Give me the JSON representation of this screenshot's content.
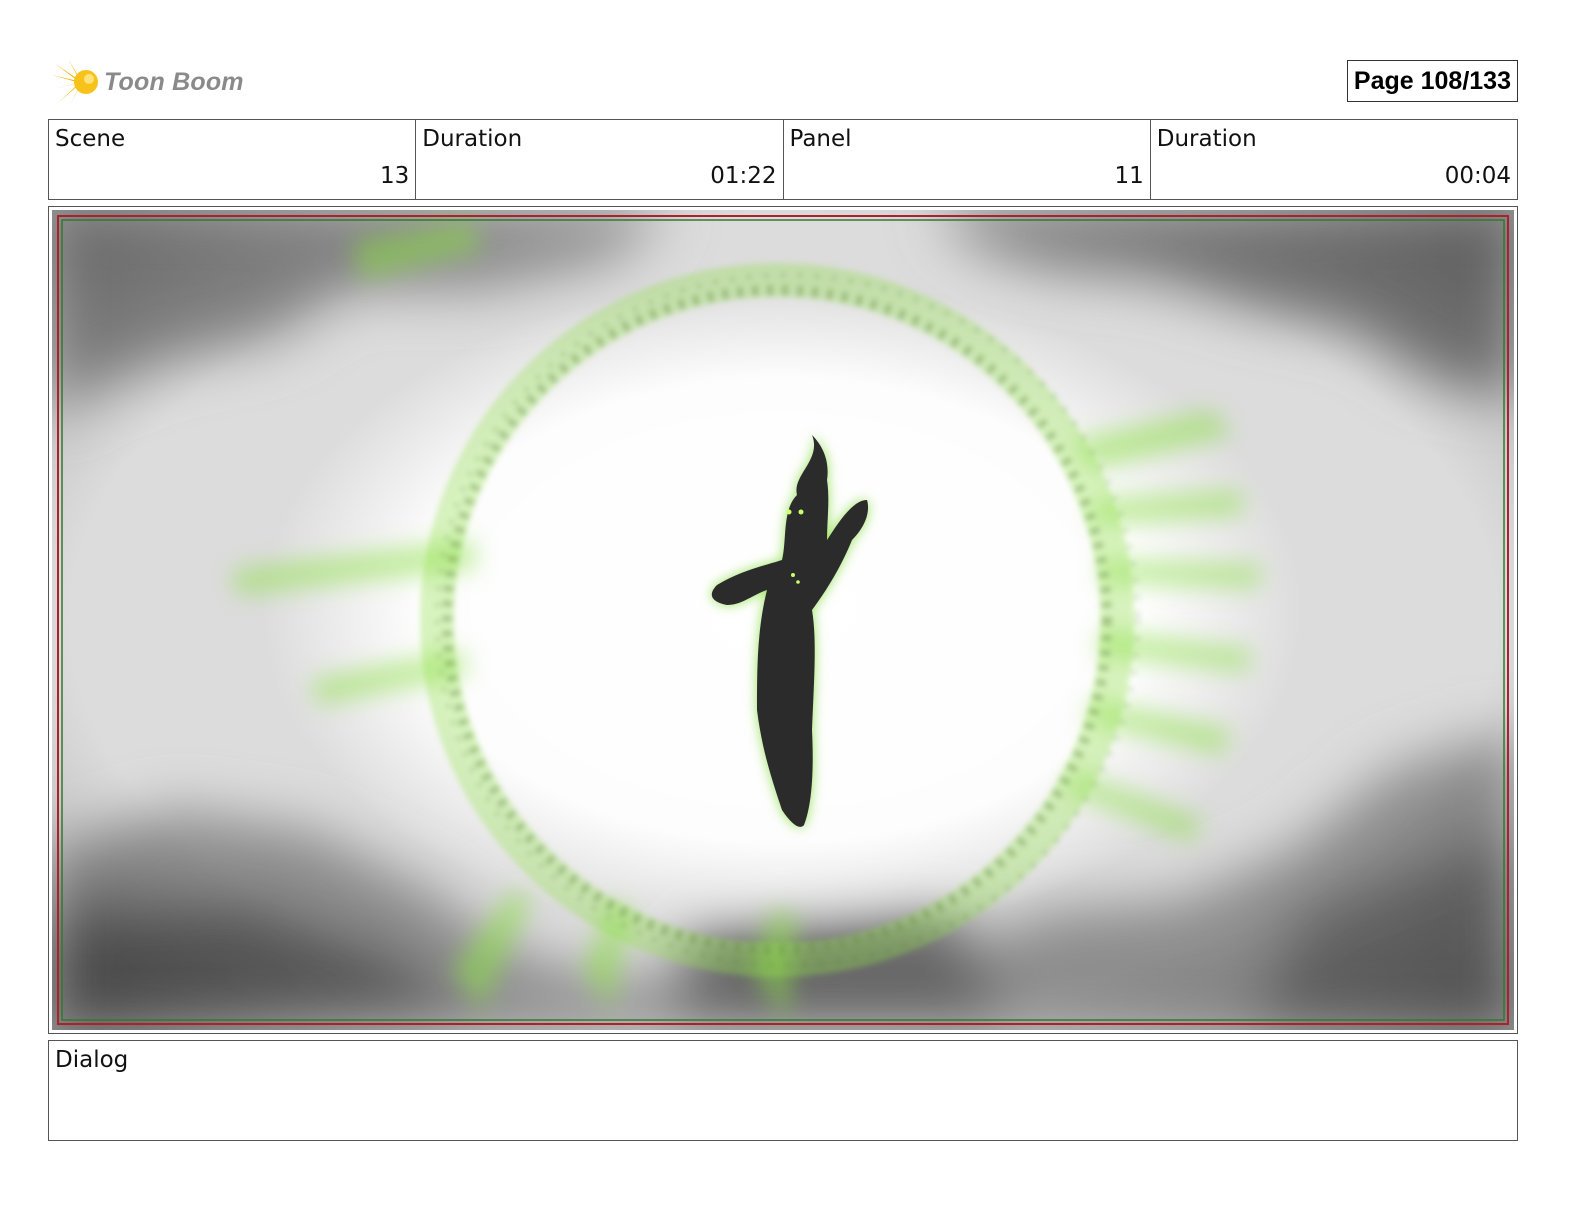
{
  "header": {
    "brand": "Toon Boom",
    "page": "Page 108/133"
  },
  "info": {
    "scene_label": "Scene",
    "scene_value": "13",
    "scene_duration_label": "Duration",
    "scene_duration_value": "01:22",
    "panel_label": "Panel",
    "panel_value": "11",
    "panel_duration_label": "Duration",
    "panel_duration_value": "00:04"
  },
  "dialog": {
    "label": "Dialog",
    "text": ""
  },
  "colors": {
    "brand_orange": "#f5b400",
    "glow_green": "#8ee04a",
    "frame_red": "#b0202a",
    "frame_green": "#2f7a2f"
  },
  "icons": {
    "logo": "starburst-icon"
  }
}
